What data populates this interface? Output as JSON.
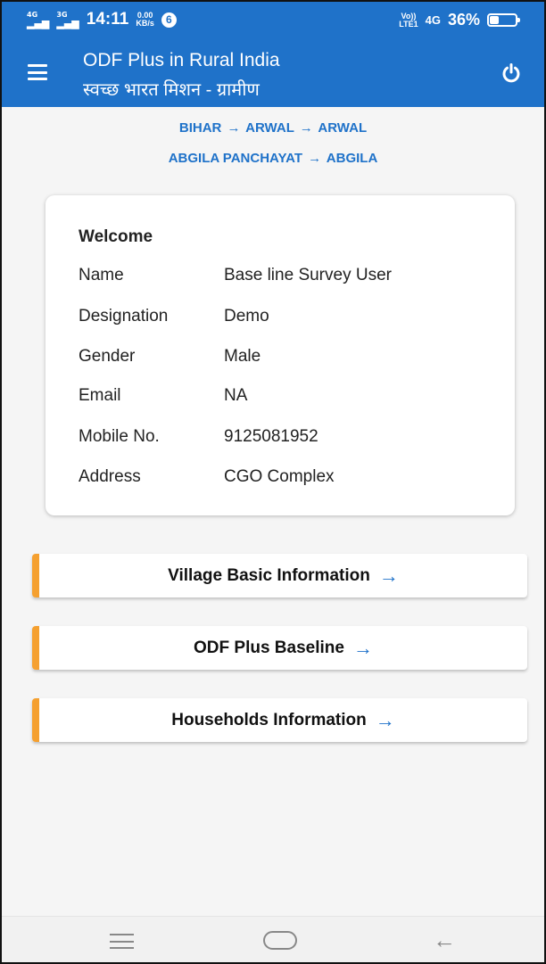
{
  "status_bar": {
    "signal1": "4G",
    "signal2": "3G",
    "time": "14:11",
    "speed_value": "0.00",
    "speed_unit": "KB/s",
    "badge": "6",
    "volte_top": "Vo))",
    "volte_bottom": "LTE1",
    "network": "4G",
    "battery_percent": "36%",
    "battery_level": 0.36
  },
  "app_bar": {
    "title": "ODF Plus in Rural India",
    "subtitle": "स्वच्छ भारत मिशन - ग्रामीण",
    "menu_icon": "menu-icon",
    "power_icon": "power-icon"
  },
  "breadcrumb": {
    "line1": [
      "BIHAR",
      "ARWAL",
      "ARWAL"
    ],
    "line2": [
      "ABGILA PANCHAYAT",
      "ABGILA"
    ],
    "arrow": "→"
  },
  "profile": {
    "heading": "Welcome",
    "rows": [
      {
        "label": "Name",
        "value": "Base line Survey User"
      },
      {
        "label": "Designation",
        "value": "Demo"
      },
      {
        "label": "Gender",
        "value": "Male"
      },
      {
        "label": "Email",
        "value": "NA"
      },
      {
        "label": "Mobile No.",
        "value": "9125081952"
      },
      {
        "label": "Address",
        "value": "CGO Complex"
      }
    ]
  },
  "actions": [
    {
      "label": "Village Basic Information",
      "arrow": "→"
    },
    {
      "label": "ODF Plus Baseline",
      "arrow": "→"
    },
    {
      "label": "Households Information",
      "arrow": "→"
    }
  ],
  "colors": {
    "primary": "#1f72c9",
    "accent": "#f5a030"
  },
  "nav_bar": {
    "recent_icon": "recent-apps-icon",
    "home_icon": "home-icon",
    "back_icon": "back-icon",
    "back_glyph": "←"
  }
}
